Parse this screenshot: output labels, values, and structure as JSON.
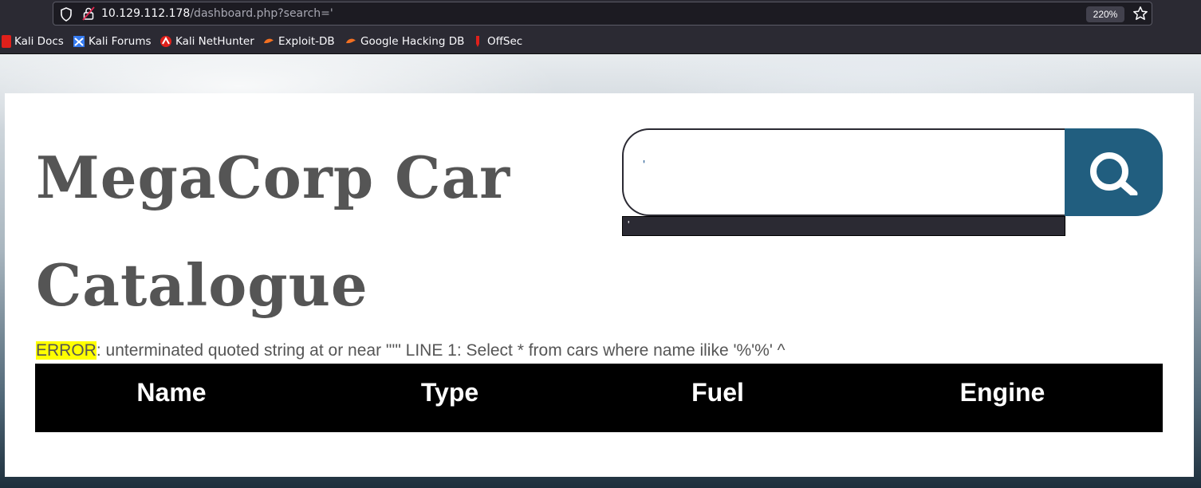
{
  "browser": {
    "url_host": "10.129.112.178",
    "url_path": "/dashboard.php?search='",
    "zoom": "220%",
    "bookmarks": [
      {
        "label": "Kali Docs",
        "icon": "kali-docs-icon",
        "color": "#e0201b"
      },
      {
        "label": "Kali Forums",
        "icon": "kali-forums-icon",
        "color": "#367bf0"
      },
      {
        "label": "Kali NetHunter",
        "icon": "kali-nethunter-icon",
        "color": "#e0201b"
      },
      {
        "label": "Exploit-DB",
        "icon": "exploit-db-icon",
        "color": "#f37021"
      },
      {
        "label": "Google Hacking DB",
        "icon": "ghdb-icon",
        "color": "#f37021"
      },
      {
        "label": "OffSec",
        "icon": "offsec-icon",
        "color": "#e0201b"
      }
    ]
  },
  "page": {
    "title": "MegaCorp Car Catalogue",
    "search": {
      "value": "'",
      "autocomplete_suggestion": "'"
    },
    "error": {
      "label": "ERROR",
      "message": ": unterminated quoted string at or near \"'\" LINE 1: Select * from cars where name ilike '%'%' ^"
    },
    "table": {
      "headers": [
        "Name",
        "Type",
        "Fuel",
        "Engine"
      ]
    }
  },
  "colors": {
    "search_button": "#215e7f",
    "error_highlight": "#ffff00",
    "table_header_bg": "#000000"
  }
}
